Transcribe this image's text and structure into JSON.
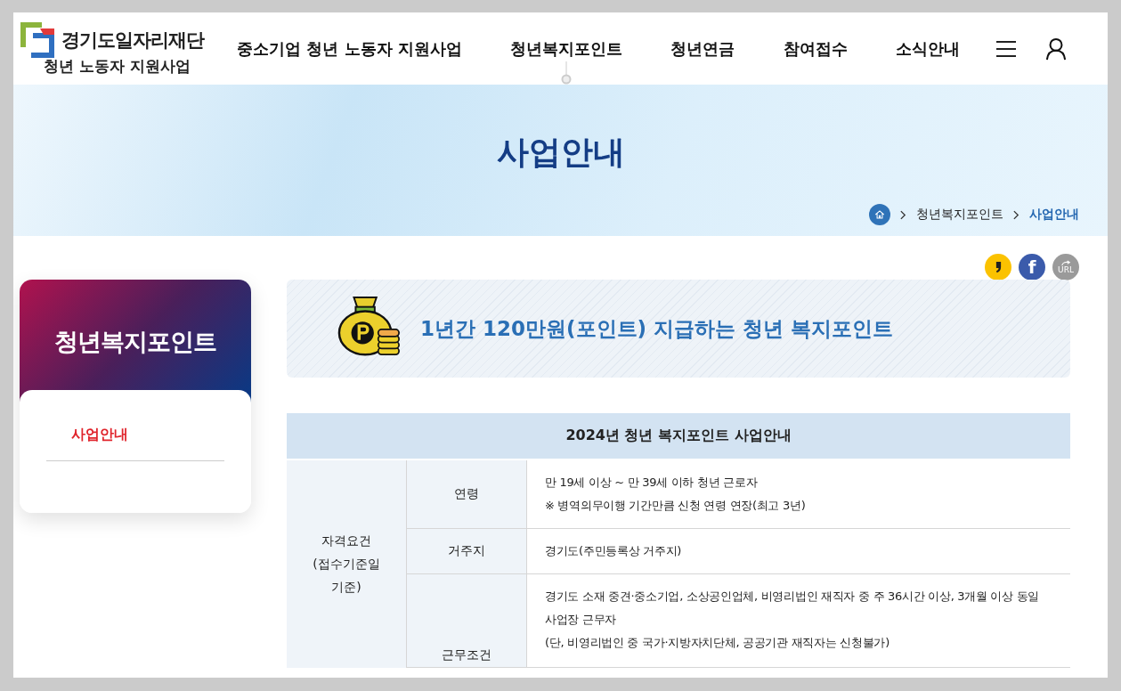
{
  "header": {
    "org_name": "경기도일자리재단",
    "site_name": "청년 노동자 지원사업",
    "nav": [
      {
        "label": "중소기업 청년 노동자 지원사업",
        "selected": false
      },
      {
        "label": "청년복지포인트",
        "selected": true
      },
      {
        "label": "청년연금",
        "selected": false
      },
      {
        "label": "참여접수",
        "selected": false
      },
      {
        "label": "소식안내",
        "selected": false
      }
    ]
  },
  "banner": {
    "title": "사업안내",
    "breadcrumb": [
      {
        "label": "청년복지포인트",
        "current": false
      },
      {
        "label": "사업안내",
        "current": true
      }
    ]
  },
  "share": [
    {
      "kind": "kakao"
    },
    {
      "kind": "facebook",
      "label": "f"
    },
    {
      "kind": "url",
      "label": "URL"
    }
  ],
  "sidebar": {
    "title": "청년복지포인트",
    "items": [
      {
        "label": "사업안내",
        "selected": true
      }
    ]
  },
  "intro": {
    "text": "1년간 120만원(포인트) 지급하는 청년 복지포인트"
  },
  "table": {
    "title": "2024년 청년 복지포인트 사업안내",
    "group": {
      "lines": [
        "자격요건",
        "(접수기준일",
        "기준)"
      ]
    },
    "rows": [
      {
        "label": "연령",
        "lines": [
          "만 19세 이상 ~ 만 39세 이하 청년 근로자",
          "※ 병역의무이행 기간만큼 신청 연령 연장(최고 3년)"
        ]
      },
      {
        "label": "거주지",
        "lines": [
          "경기도(주민등록상 거주지)"
        ]
      },
      {
        "label": "근무조건",
        "lines": [
          "경기도 소재 중견·중소기업, 소상공인업체, 비영리법인 재직자 중 주 36시간 이상, 3개월 이상 동일 사업장 근무자",
          "(단, 비영리법인 중 국가·지방자치단체, 공공기관 재직자는 신청불가)"
        ]
      }
    ]
  }
}
